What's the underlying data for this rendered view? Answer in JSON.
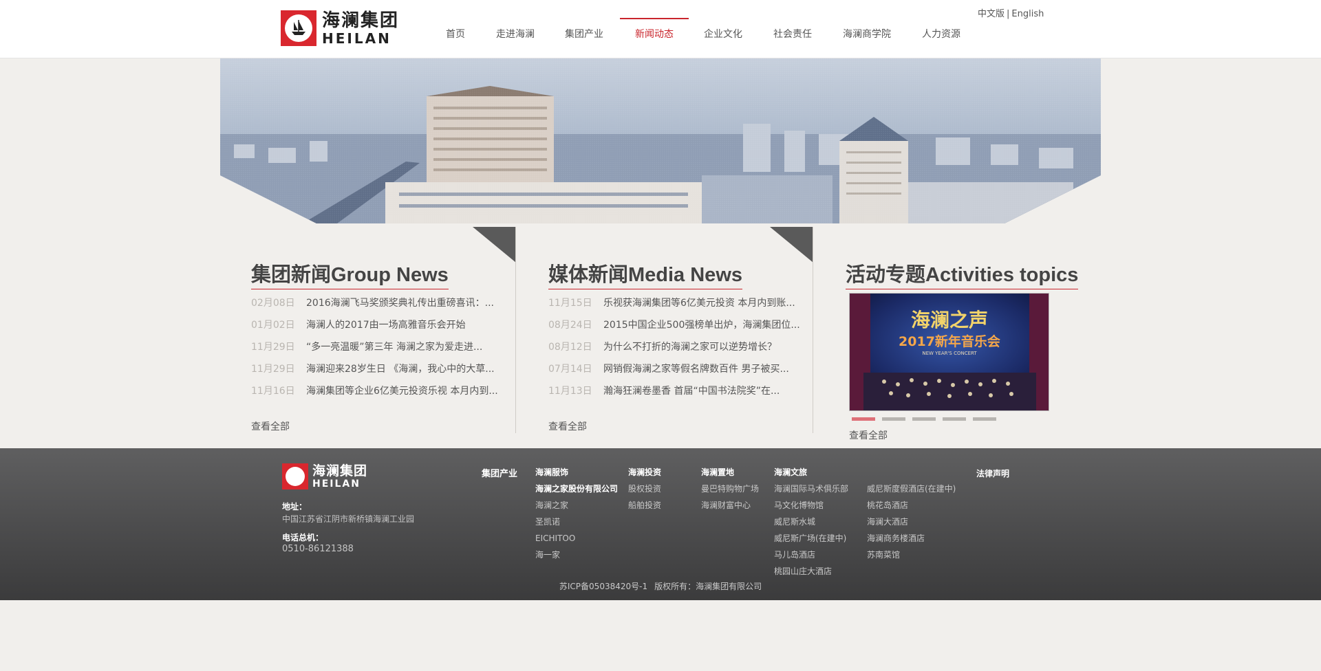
{
  "header": {
    "logo": {
      "cn": "海澜集团",
      "en": "HEILAN"
    },
    "lang": {
      "zh": "中文版",
      "sep": "|",
      "en": "English"
    },
    "nav": [
      "首页",
      "走进海澜",
      "集团产业",
      "新闻动态",
      "企业文化",
      "社会责任",
      "海澜商学院",
      "人力资源"
    ],
    "active_nav": "新闻动态"
  },
  "sections": {
    "group_news": {
      "title": "集团新闻Group News",
      "items": [
        {
          "date": "02月08日",
          "title": "2016海澜飞马奖颁奖典礼传出重磅喜讯：..."
        },
        {
          "date": "01月02日",
          "title": "海澜人的2017由一场高雅音乐会开始"
        },
        {
          "date": "11月29日",
          "title": "“多一亮温暖”第三年 海澜之家为爱走进..."
        },
        {
          "date": "11月29日",
          "title": "海澜迎来28岁生日 《海澜，我心中的大草..."
        },
        {
          "date": "11月16日",
          "title": "海澜集团等企业6亿美元投资乐视 本月内到..."
        }
      ],
      "view_all": "查看全部"
    },
    "media_news": {
      "title": "媒体新闻Media News",
      "items": [
        {
          "date": "11月15日",
          "title": "乐视获海澜集团等6亿美元投资 本月内到账..."
        },
        {
          "date": "08月24日",
          "title": "2015中国企业500强榜单出炉，海澜集团位..."
        },
        {
          "date": "08月12日",
          "title": "为什么不打折的海澜之家可以逆势增长？"
        },
        {
          "date": "07月14日",
          "title": "网销假海澜之家等假名牌数百件 男子被买..."
        },
        {
          "date": "11月13日",
          "title": "瀚海狂澜卷墨香 首届“中国书法院奖”在..."
        }
      ],
      "view_all": "查看全部"
    },
    "activities": {
      "title": "活动专题Activities topics",
      "slide": {
        "line1": "海澜之声",
        "line2": "2017新年音乐会",
        "line3": "NEW YEAR'S CONCERT"
      },
      "dots": 5,
      "active_dot": 0,
      "view_all": "查看全部"
    }
  },
  "footer": {
    "logo": {
      "cn": "海澜集团",
      "en": "HEILAN"
    },
    "address_label": "地址：",
    "address": "中国江苏省江阴市新桥镇海澜工业园",
    "phone_label": "电话总机：",
    "phone": "0510-86121388",
    "industry_head": "集团产业",
    "columns": [
      {
        "head": "海澜服饰",
        "items": [
          "海澜之家股份有限公司",
          "海澜之家",
          "圣凯诺",
          "EICHITOO",
          "海一家"
        ],
        "strong_first": true
      },
      {
        "head": "海澜投资",
        "items": [
          "股权投资",
          "船舶投资"
        ]
      },
      {
        "head": "海澜置地",
        "items": [
          "曼巴特购物广场",
          "海澜财富中心"
        ]
      },
      {
        "head": "海澜文旅",
        "items": [
          "海澜国际马术俱乐部",
          "马文化博物馆",
          "威尼斯水城",
          "威尼斯广场(在建中)",
          "马儿岛酒店",
          "桃园山庄大酒店"
        ]
      },
      {
        "head": "",
        "items": [
          "威尼斯度假酒店(在建中)",
          "桃花岛酒店",
          "海澜大酒店",
          "海澜商务楼酒店",
          "苏南菜馆"
        ]
      }
    ],
    "legal": "法律声明",
    "icp": "苏ICP备05038420号-1",
    "copyright": "版权所有：海澜集团有限公司"
  },
  "colors": {
    "accent": "#c9252c",
    "footer_bg": "#4a4a4b",
    "page_bg": "#f1efec"
  }
}
